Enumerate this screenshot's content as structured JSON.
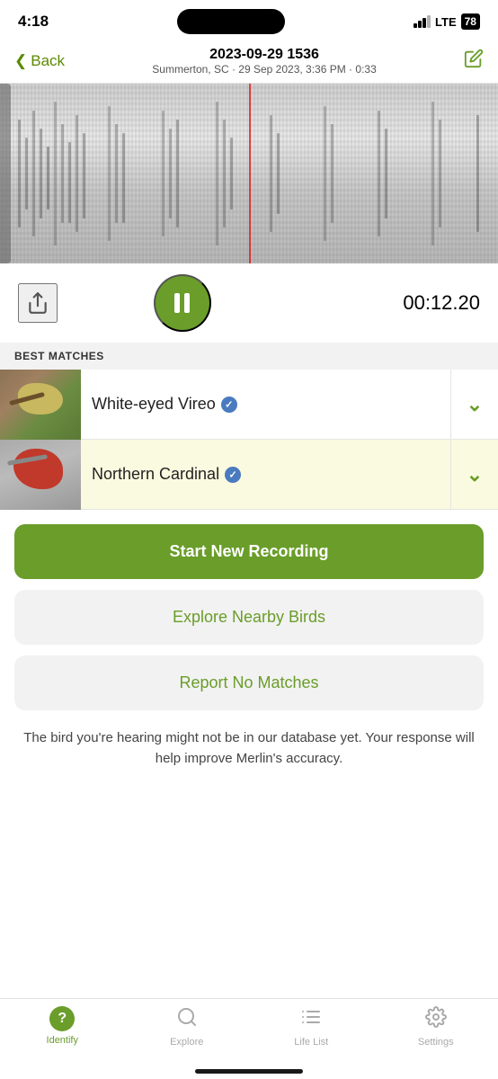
{
  "statusBar": {
    "time": "4:18",
    "lte": "LTE",
    "battery": "78"
  },
  "navBar": {
    "backLabel": "Back",
    "title": "2023-09-29 1536",
    "subtitle": "Summerton, SC · 29 Sep 2023, 3:36 PM · 0:33"
  },
  "controls": {
    "timer": "00:12.20"
  },
  "bestMatches": {
    "header": "BEST MATCHES",
    "items": [
      {
        "name": "White-eyed Vireo",
        "verified": true,
        "highlighted": false
      },
      {
        "name": "Northern Cardinal",
        "verified": true,
        "highlighted": true
      }
    ]
  },
  "buttons": {
    "startNewRecording": "Start New Recording",
    "exploreNearbyBirds": "Explore Nearby Birds",
    "reportNoMatches": "Report No Matches"
  },
  "helperText": "The bird you're hearing might not be in our database yet. Your response will help improve Merlin's accuracy.",
  "tabBar": {
    "items": [
      {
        "label": "Identify",
        "active": true
      },
      {
        "label": "Explore",
        "active": false
      },
      {
        "label": "Life List",
        "active": false
      },
      {
        "label": "Settings",
        "active": false
      }
    ]
  }
}
